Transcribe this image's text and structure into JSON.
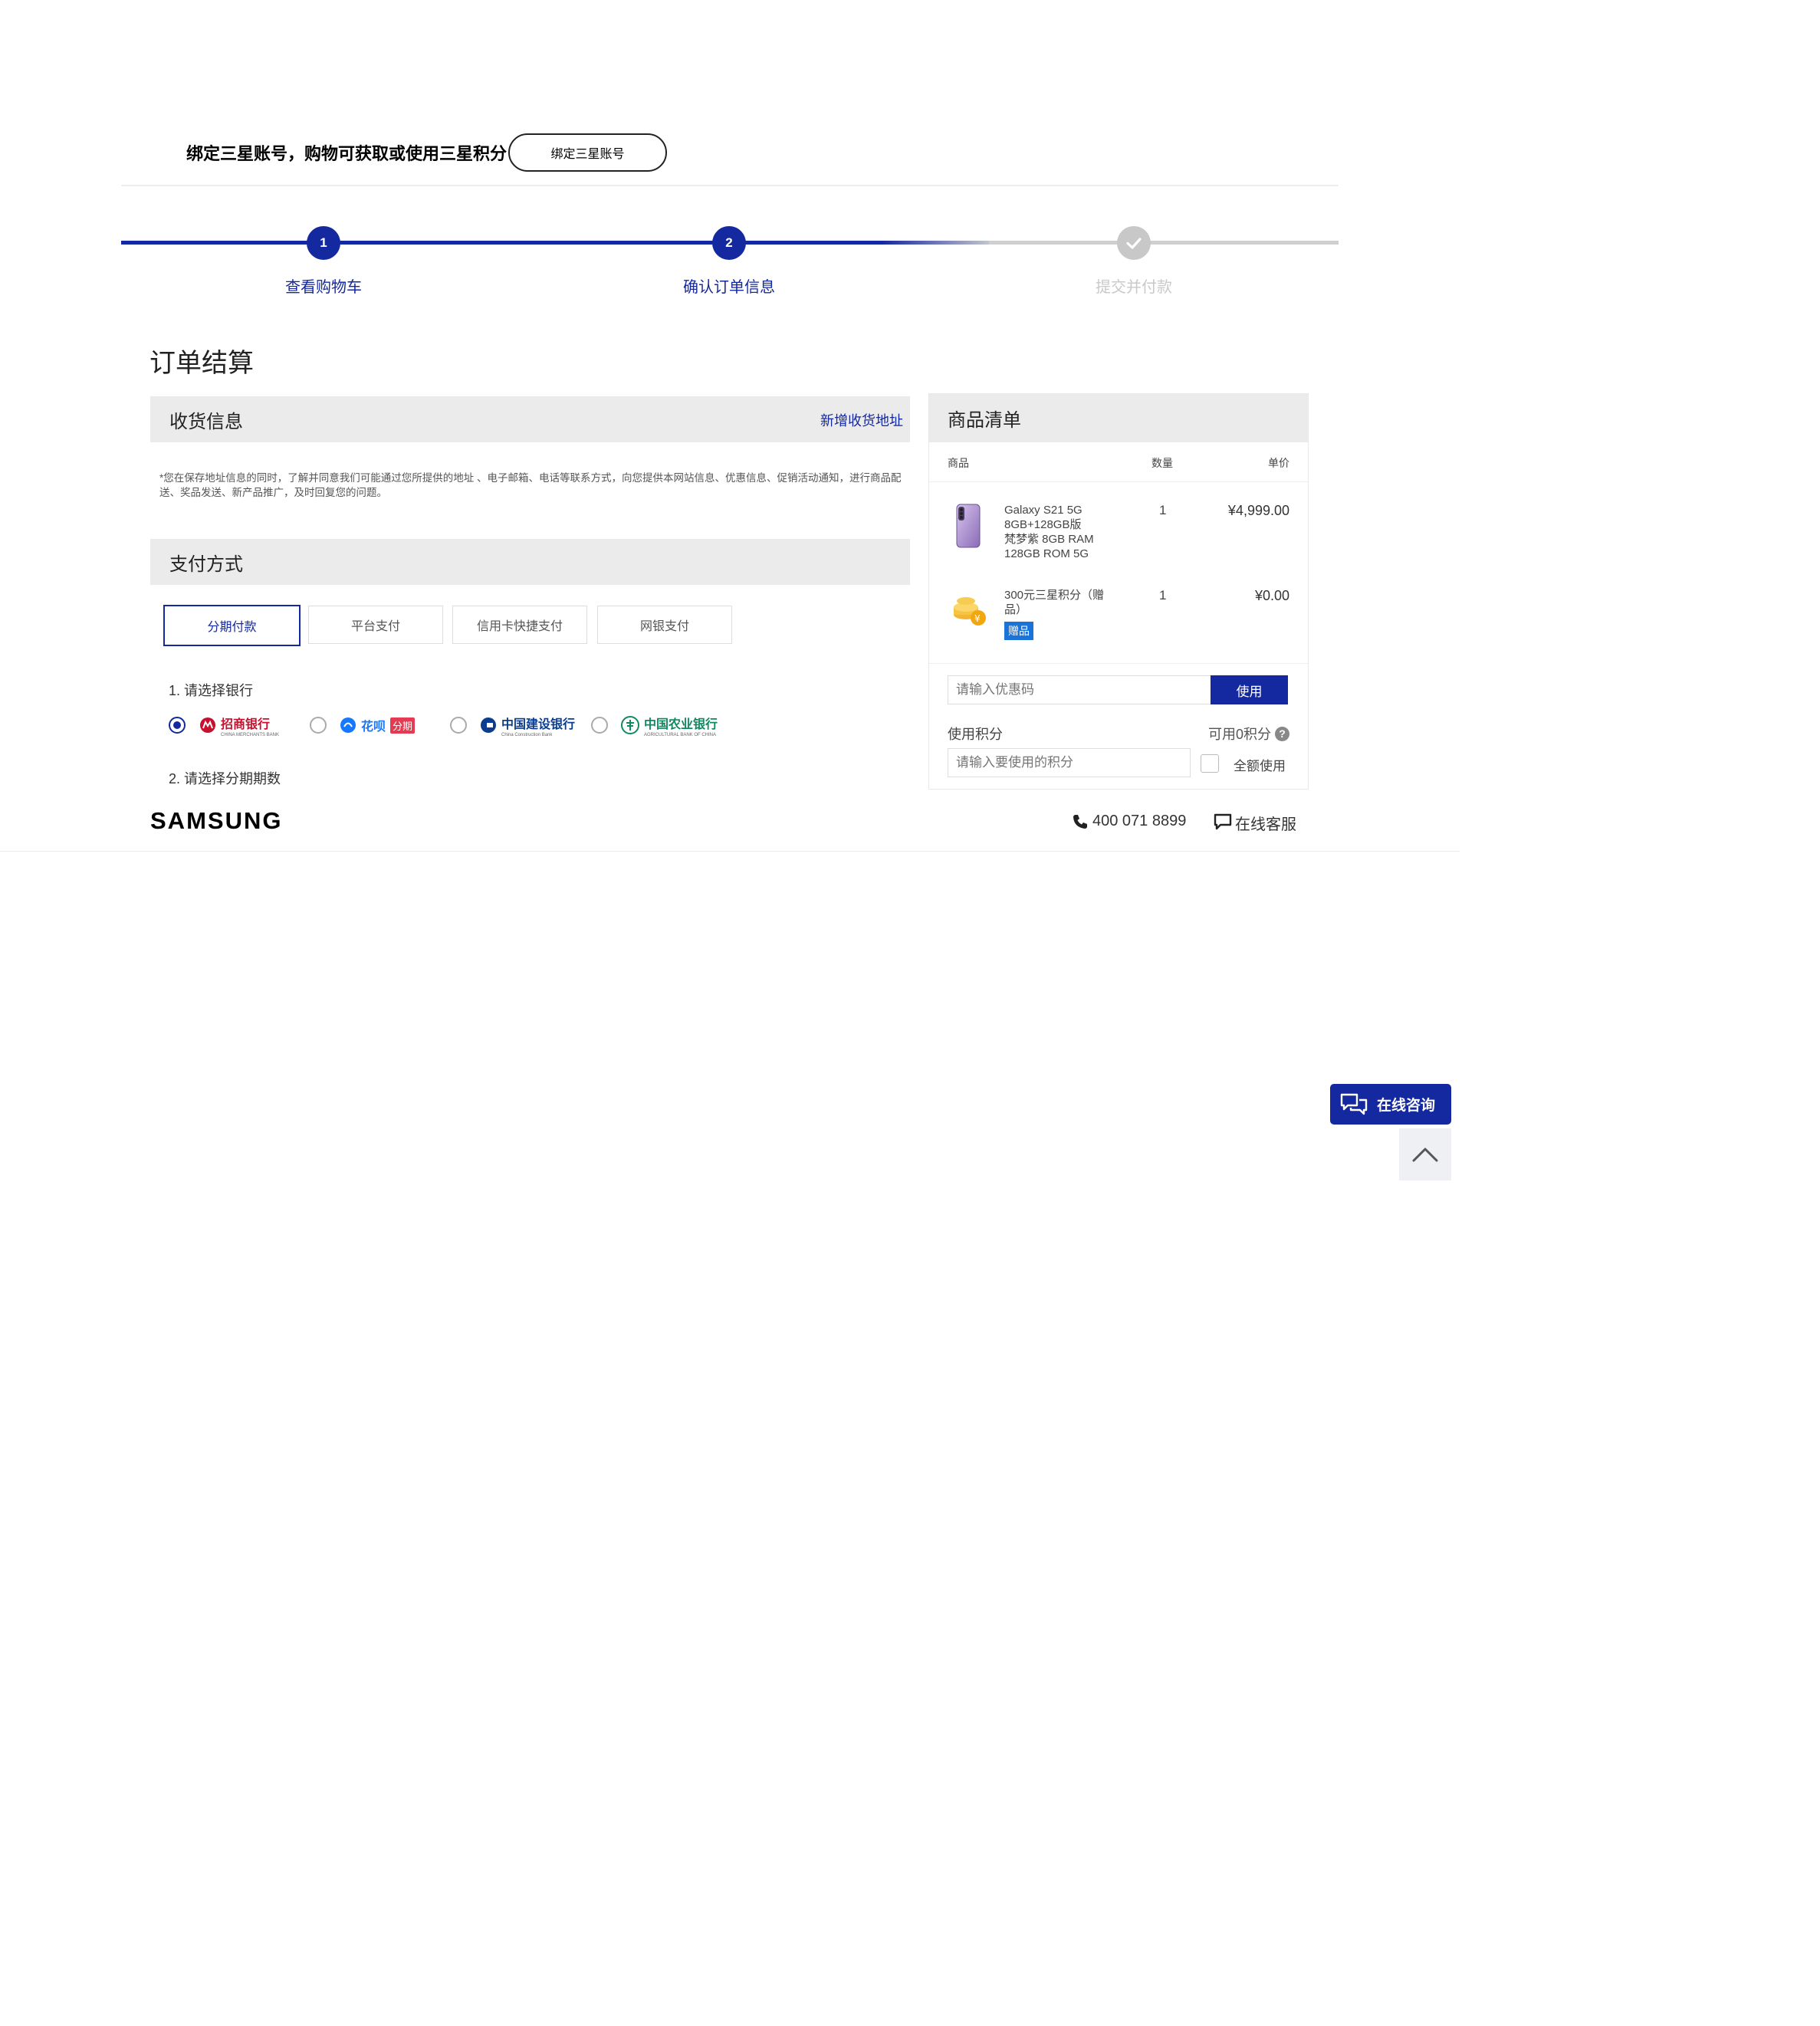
{
  "bind_bar": {
    "message": "绑定三星账号，购物可获取或使用三星积分",
    "button_label": "绑定三星账号"
  },
  "progress": {
    "steps": [
      {
        "number": "1",
        "label": "查看购物车",
        "state": "done"
      },
      {
        "number": "2",
        "label": "确认订单信息",
        "state": "current"
      },
      {
        "number": "",
        "label": "提交并付款",
        "state": "pending"
      }
    ]
  },
  "page_title": "订单结算",
  "shipping": {
    "title": "收货信息",
    "add_address": "新增收货地址",
    "privacy_note": "*您在保存地址信息的同时，了解并同意我们可能通过您所提供的地址 、电子邮箱、电话等联系方式，向您提供本网站信息、优惠信息、促销活动通知，进行商品配送、奖品发送、新产品推广，及时回复您的问题。"
  },
  "payment": {
    "title": "支付方式",
    "tabs": [
      "分期付款",
      "平台支付",
      "信用卡快捷支付",
      "网银支付"
    ],
    "active_tab": 0,
    "select_bank_label": "1. 请选择银行",
    "banks": [
      {
        "name": "招商银行",
        "sub": "CHINA MERCHANTS BANK",
        "checked": true,
        "color": "#c8102e"
      },
      {
        "name": "花呗",
        "sub": "分期",
        "checked": false,
        "color": "#1677ff"
      },
      {
        "name": "中国建设银行",
        "sub": "China Construction Bank",
        "checked": false,
        "color": "#0a3d91"
      },
      {
        "name": "中国农业银行",
        "sub": "AGRICULTURAL BANK OF CHINA",
        "checked": false,
        "color": "#0f8a5f"
      }
    ],
    "select_term_label": "2. 请选择分期期数"
  },
  "cart": {
    "title": "商品清单",
    "columns": {
      "product": "商品",
      "qty": "数量",
      "price": "单价"
    },
    "items": [
      {
        "name_line1": "Galaxy S21 5G",
        "name_line2": "8GB+128GB版",
        "name_line3": "梵梦紫 8GB RAM",
        "name_line4": "128GB ROM 5G",
        "qty": "1",
        "price": "¥4,999.00"
      },
      {
        "name_line1": "300元三星积分（赠",
        "name_line2": "品）",
        "badge": "赠品",
        "qty": "1",
        "price": "¥0.00"
      }
    ],
    "coupon_placeholder": "请输入优惠码",
    "coupon_button": "使用",
    "points_label": "使用积分",
    "points_available": "可用0积分",
    "points_help": "?",
    "points_placeholder": "请输入要使用的积分",
    "full_use_label": "全额使用"
  },
  "footer": {
    "brand": "SAMSUNG",
    "phone": "400 071 8899",
    "online_service": "在线客服"
  },
  "float": {
    "consult_label": "在线咨询"
  },
  "colors": {
    "brand_blue": "#1428a0",
    "panel_gray": "#ebebeb"
  }
}
